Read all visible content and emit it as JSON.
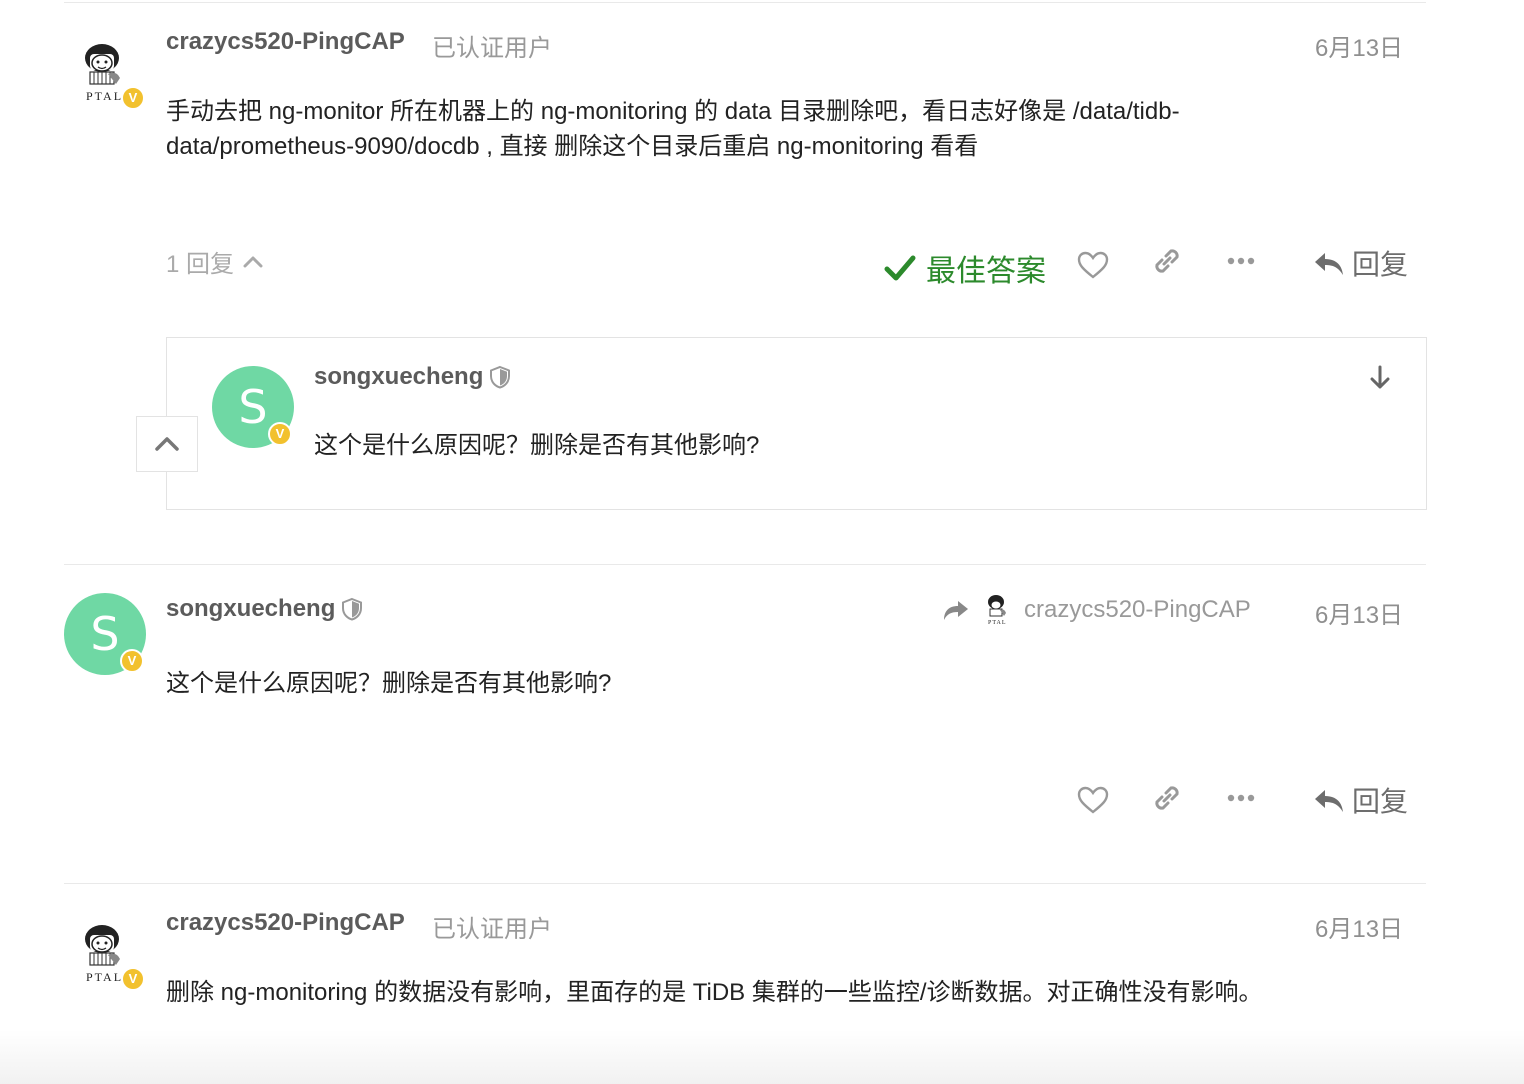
{
  "posts": [
    {
      "username": "crazycs520-PingCAP",
      "user_title": "已认证用户",
      "date": "6月13日",
      "avatar_caption": "PTAL",
      "badge": "V",
      "body": "手动去把 ng-monitor 所在机器上的 ng-monitoring 的 data 目录删除吧，看日志好像是 /data/tidb-data/prometheus-9090/docdb , 直接 删除这个目录后重启 ng-monitoring 看看",
      "replies_label": "1 回复",
      "solution_label": "最佳答案",
      "reply_label": "回复"
    },
    {
      "username": "songxuecheng",
      "avatar_letter": "S",
      "badge": "V",
      "date": "6月13日",
      "reply_to": "crazycs520-PingCAP",
      "reply_to_caption": "PTAL",
      "body": "这个是什么原因呢？删除是否有其他影响?",
      "reply_label": "回复"
    },
    {
      "username": "crazycs520-PingCAP",
      "user_title": "已认证用户",
      "date": "6月13日",
      "avatar_caption": "PTAL",
      "badge": "V",
      "body": "删除 ng-monitoring 的数据没有影响，里面存的是 TiDB 集群的一些监控/诊断数据。对正确性没有影响。"
    }
  ],
  "embedded_reply": {
    "username": "songxuecheng",
    "avatar_letter": "S",
    "badge": "V",
    "body": "这个是什么原因呢？删除是否有其他影响?"
  },
  "icons": {
    "solution": "check-icon",
    "like": "heart-icon",
    "share": "link-icon",
    "more": "ellipsis-icon",
    "reply": "reply-arrow-icon",
    "collapse": "chevron-up-icon",
    "jump": "arrow-down-icon",
    "moderator": "shield-icon",
    "reply_to": "share-arrow-icon"
  },
  "colors": {
    "avatar_green": "#6fd8a4",
    "badge_gold": "#f2c12e",
    "solution_green": "#2c8a2c"
  }
}
